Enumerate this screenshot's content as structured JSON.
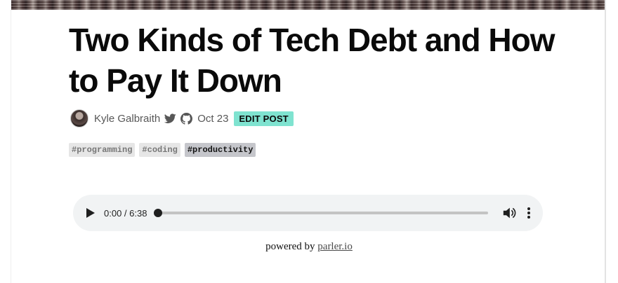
{
  "article": {
    "title": "Two Kinds of Tech Debt and How to Pay It Down",
    "author": "Kyle Galbraith",
    "date": "Oct 23",
    "edit_label": "EDIT POST",
    "tags": [
      "#programming",
      "#coding",
      "#productivity"
    ],
    "active_tag_index": 2
  },
  "audio": {
    "time_display": "0:00 / 6:38",
    "progress_fraction": 0
  },
  "footer": {
    "powered_by_prefix": "powered by",
    "powered_by_link": "parler.io"
  },
  "icons": {
    "avatar": "avatar",
    "twitter": "twitter-icon",
    "github": "github-icon",
    "play": "play-icon",
    "volume": "volume-icon",
    "more": "more-vertical-icon"
  },
  "colors": {
    "edit_post_bg": "#7fe3d0",
    "tag_bg": "#e6e6e6",
    "tag_active_bg": "#c5c6cb",
    "player_bg": "#f1f3f4"
  }
}
